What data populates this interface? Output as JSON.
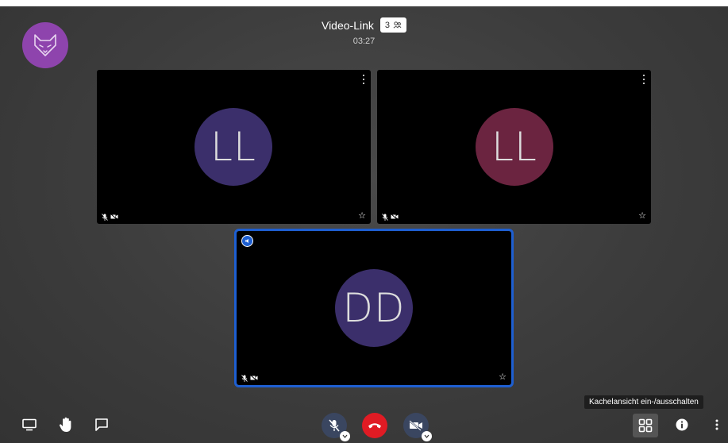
{
  "header": {
    "title": "Video-Link",
    "participant_count": "3",
    "timer": "03:27"
  },
  "tiles": [
    {
      "initials": "LL",
      "avatar_color": "#3b2f6b"
    },
    {
      "initials": "LL",
      "avatar_color": "#6b2440"
    },
    {
      "initials": "DD",
      "avatar_color": "#3b2f6b",
      "active_speaker": true
    }
  ],
  "toolbar": {
    "tooltip": "Kachelansicht ein-/ausschalten",
    "hangup_color": "#e01b24",
    "accent_color": "#1e5fd1",
    "logo_color": "#8e44ad"
  }
}
